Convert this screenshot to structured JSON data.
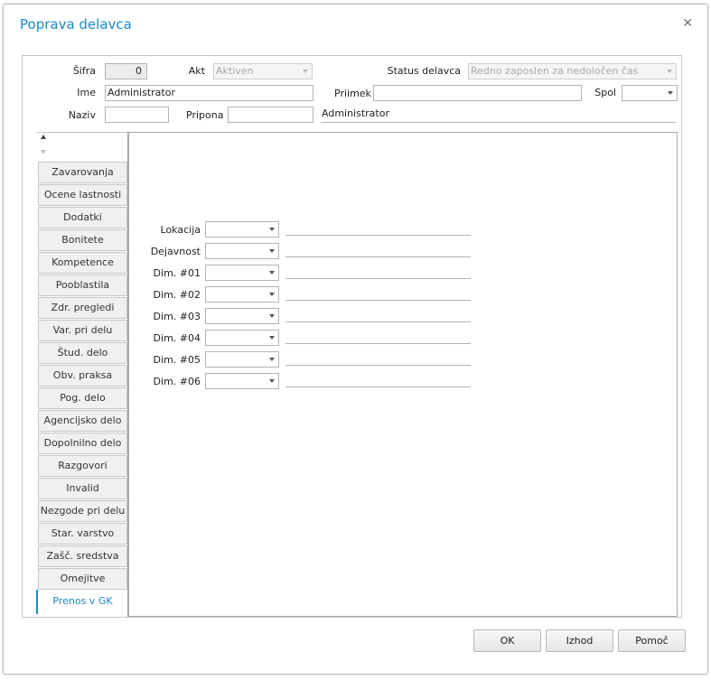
{
  "dialog": {
    "title": "Poprava delavca",
    "close_icon": "close-icon"
  },
  "header": {
    "sifra_label": "Šifra",
    "sifra_value": "0",
    "akt_label": "Akt",
    "akt_value": "Aktiven",
    "status_label": "Status delavca",
    "status_value": "Redno zaposlen za nedoločen čas",
    "ime_label": "Ime",
    "ime_value": "Administrator",
    "priimek_label": "Priimek",
    "priimek_value": "",
    "spol_label": "Spol",
    "spol_value": "",
    "naziv_label": "Naziv",
    "naziv_value": "",
    "pripona_label": "Pripona",
    "pripona_value": "",
    "full_name": "Administrator"
  },
  "tabs": [
    "Zavarovanja",
    "Ocene lastnosti",
    "Dodatki",
    "Bonitete",
    "Kompetence",
    "Pooblastila",
    "Zdr. pregledi",
    "Var. pri delu",
    "Štud. delo",
    "Obv. praksa",
    "Pog. delo",
    "Agencijsko delo",
    "Dopolnilno delo",
    "Razgovori",
    "Invalid",
    "Nezgode pri delu",
    "Star. varstvo",
    "Zašč. sredstva",
    "Omejitve",
    "Prenos v GK"
  ],
  "active_tab": "Prenos v GK",
  "gk_fields": [
    {
      "label": "Lokacija",
      "value": "",
      "description": ""
    },
    {
      "label": "Dejavnost",
      "value": "",
      "description": ""
    },
    {
      "label": "Dim. #01",
      "value": "",
      "description": ""
    },
    {
      "label": "Dim. #02",
      "value": "",
      "description": ""
    },
    {
      "label": "Dim. #03",
      "value": "",
      "description": ""
    },
    {
      "label": "Dim. #04",
      "value": "",
      "description": ""
    },
    {
      "label": "Dim. #05",
      "value": "",
      "description": ""
    },
    {
      "label": "Dim. #06",
      "value": "",
      "description": ""
    }
  ],
  "buttons": {
    "ok": "OK",
    "exit": "Izhod",
    "help": "Pomoč"
  },
  "colors": {
    "accent": "#1d8ac6"
  }
}
